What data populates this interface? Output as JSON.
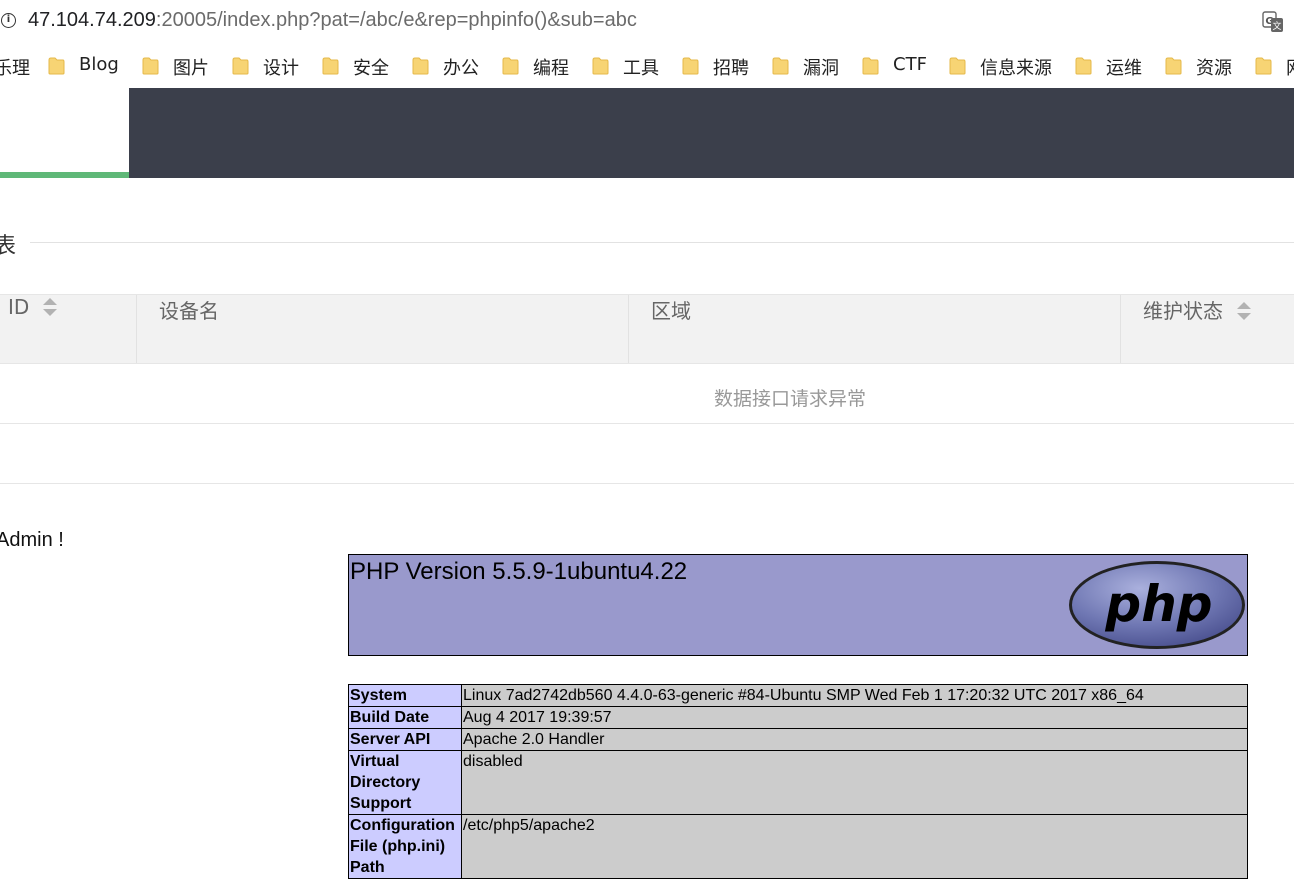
{
  "browser": {
    "url_host": "47.104.74.209",
    "url_rest": ":20005/index.php?pat=/abc/e&rep=phpinfo()&sub=abc",
    "bookmarks": [
      {
        "label": "乐理",
        "folder": false
      },
      {
        "label": "Blog",
        "folder": true
      },
      {
        "label": "图片",
        "folder": true
      },
      {
        "label": "设计",
        "folder": true
      },
      {
        "label": "安全",
        "folder": true
      },
      {
        "label": "办公",
        "folder": true
      },
      {
        "label": "编程",
        "folder": true
      },
      {
        "label": "工具",
        "folder": true
      },
      {
        "label": "招聘",
        "folder": true
      },
      {
        "label": "漏洞",
        "folder": true
      },
      {
        "label": "CTF",
        "folder": true
      },
      {
        "label": "信息来源",
        "folder": true
      },
      {
        "label": "运维",
        "folder": true
      },
      {
        "label": "资源",
        "folder": true
      },
      {
        "label": "网",
        "folder": true
      }
    ]
  },
  "colors": {
    "header_bg": "#3b3f4b",
    "accent_green": "#5fb878",
    "php_header_bg": "#9999cc",
    "php_key_bg": "#ccccff",
    "php_value_bg": "#cccccc"
  },
  "section": {
    "title": "表"
  },
  "table": {
    "columns": [
      {
        "label": "ID",
        "sortable": true
      },
      {
        "label": "设备名",
        "sortable": false
      },
      {
        "label": "区域",
        "sortable": false
      },
      {
        "label": "维护状态",
        "sortable": true
      }
    ],
    "empty_message": "数据接口请求异常"
  },
  "welcome": "Admin !",
  "phpinfo": {
    "version": "PHP Version 5.5.9-1ubuntu4.22",
    "logo_text": "php",
    "rows": [
      {
        "key": "System",
        "value": "Linux 7ad2742db560 4.4.0-63-generic #84-Ubuntu SMP Wed Feb 1 17:20:32 UTC 2017 x86_64"
      },
      {
        "key": "Build Date",
        "value": "Aug 4 2017 19:39:57"
      },
      {
        "key": "Server API",
        "value": "Apache 2.0 Handler"
      },
      {
        "key": "Virtual Directory Support",
        "value": "disabled"
      },
      {
        "key": "Configuration File (php.ini) Path",
        "value": "/etc/php5/apache2"
      }
    ]
  }
}
